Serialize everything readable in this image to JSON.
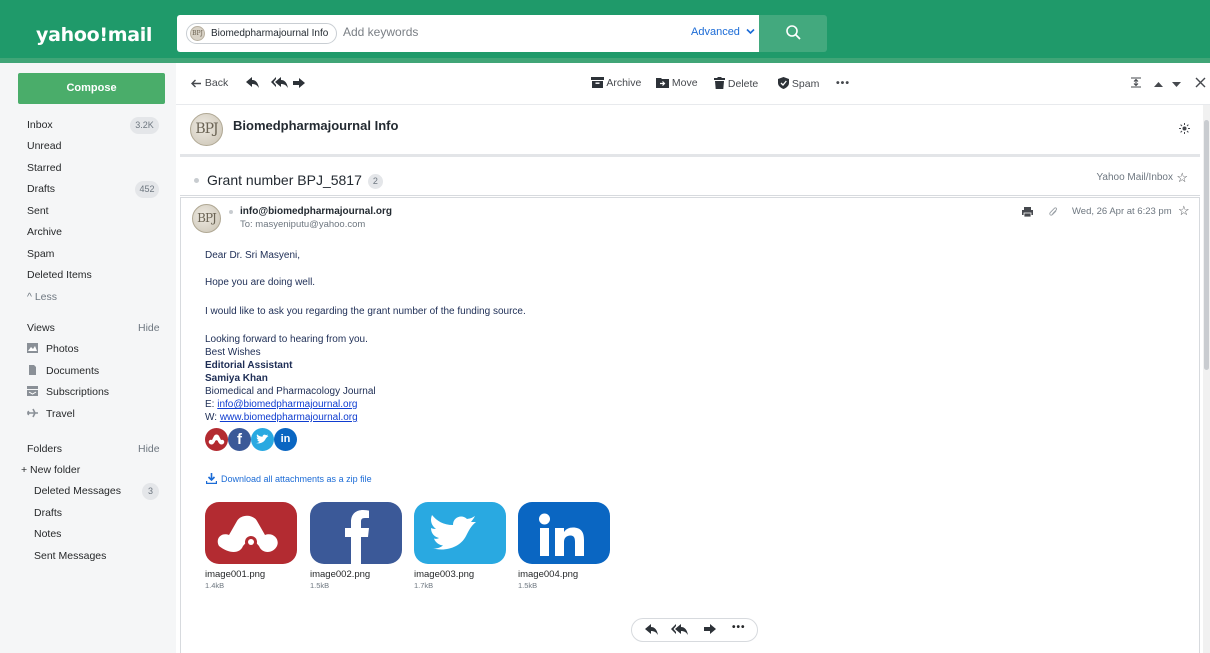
{
  "header": {
    "logo": "yahoo!mail",
    "search_chip": "Biomedpharmajournal Info",
    "search_placeholder": "Add keywords",
    "advanced_label": "Advanced"
  },
  "sidebar": {
    "compose_label": "Compose",
    "mail_items": [
      {
        "label": "Inbox",
        "count": "3.2K"
      },
      {
        "label": "Unread",
        "count": ""
      },
      {
        "label": "Starred",
        "count": ""
      },
      {
        "label": "Drafts",
        "count": "452"
      },
      {
        "label": "Sent",
        "count": ""
      },
      {
        "label": "Archive",
        "count": ""
      },
      {
        "label": "Spam",
        "count": ""
      },
      {
        "label": "Deleted Items",
        "count": ""
      },
      {
        "label": "^ Less",
        "count": ""
      }
    ],
    "views_title": "Views",
    "views_hide": "Hide",
    "views": [
      {
        "label": "Photos",
        "icon": "photo-icon"
      },
      {
        "label": "Documents",
        "icon": "document-icon"
      },
      {
        "label": "Subscriptions",
        "icon": "subscriptions-icon"
      },
      {
        "label": "Travel",
        "icon": "plane-icon"
      }
    ],
    "folders_title": "Folders",
    "folders_hide": "Hide",
    "new_folder": "+ New folder",
    "folders": [
      {
        "label": "Deleted Messages",
        "count": "3"
      },
      {
        "label": "Drafts",
        "count": ""
      },
      {
        "label": "Notes",
        "count": ""
      },
      {
        "label": "Sent Messages",
        "count": ""
      }
    ]
  },
  "toolbar": {
    "back": "Back",
    "archive": "Archive",
    "move": "Move",
    "delete": "Delete",
    "spam": "Spam",
    "more": "•••"
  },
  "message": {
    "sender_name": "Biomedpharmajournal Info",
    "avatar_text": "BPJ",
    "subject": "Grant number BPJ_5817",
    "thread_count": "2",
    "folder_label": "Yahoo Mail/Inbox",
    "from_email": "info@biomedpharmajournal.org",
    "to_line": "To: masyeniputu@yahoo.com",
    "date": "Wed, 26 Apr at 6:23 pm",
    "greeting": "Dear Dr. Sri Masyeni,",
    "line1": "Hope you are doing well.",
    "line2": "I would like to ask you regarding the grant number of the funding source.",
    "line3": "Looking forward to hearing from you.",
    "sig_wishes": "Best Wishes",
    "sig_title": "Editorial Assistant",
    "sig_name": "Samiya Khan",
    "sig_org": "Biomedical and Pharmacology Journal",
    "sig_email_prefix": "E: ",
    "sig_email": "info@biomedpharmajournal.org",
    "sig_web_prefix": "W: ",
    "sig_web": "www.biomedpharmajournal.org",
    "download_all": "Download all attachments as a zip file",
    "attachments": [
      {
        "name": "image001.png",
        "size": "1.4kB",
        "icon": "mendeley-icon"
      },
      {
        "name": "image002.png",
        "size": "1.5kB",
        "icon": "facebook-icon"
      },
      {
        "name": "image003.png",
        "size": "1.7kB",
        "icon": "twitter-icon"
      },
      {
        "name": "image004.png",
        "size": "1.5kB",
        "icon": "linkedin-icon"
      }
    ],
    "reply_more": "•••"
  },
  "colors": {
    "header_green": "#1f9a6a",
    "compose_green": "#4aad6a",
    "link_blue": "#0f3dd0",
    "mendeley_red": "#b32b31",
    "facebook_blue": "#3b5998",
    "twitter_blue": "#29a9e1",
    "linkedin_blue": "#0a66c2"
  }
}
